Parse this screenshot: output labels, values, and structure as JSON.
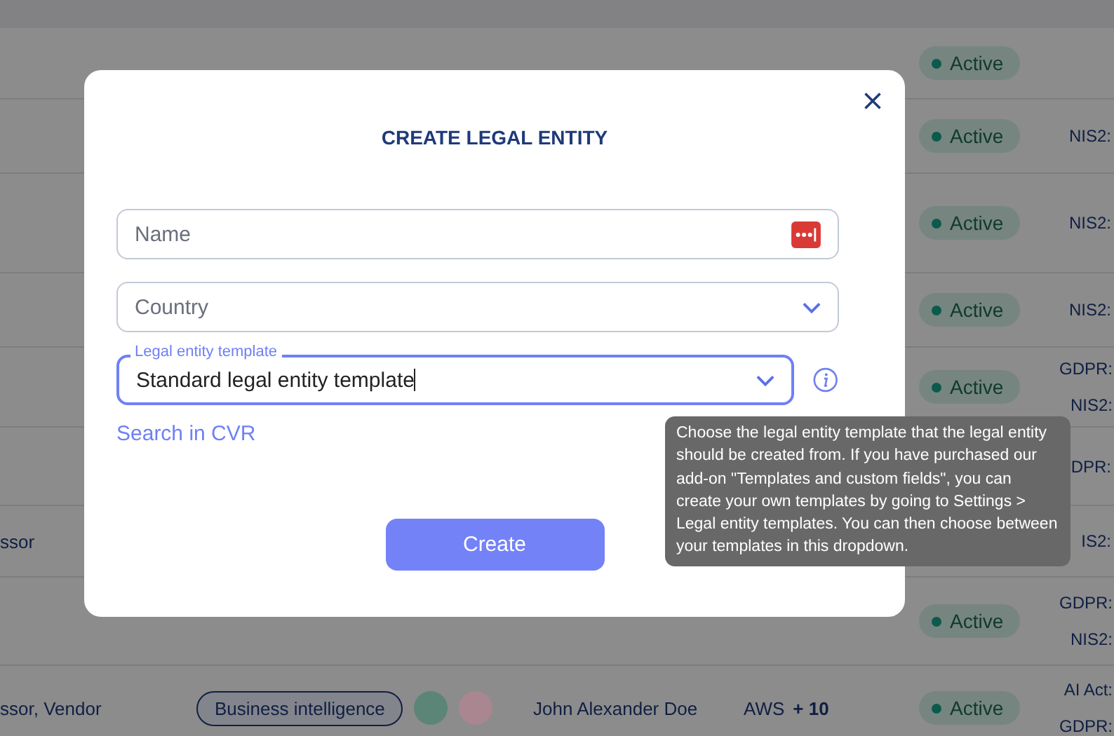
{
  "table": {
    "rows": [
      {
        "status": "Active",
        "regulations": []
      },
      {
        "status": "Active",
        "regulations": [
          "NIS2:"
        ]
      },
      {
        "status": "Active",
        "regulations": [
          "NIS2:"
        ]
      },
      {
        "status": "Active",
        "regulations": [
          "NIS2:"
        ]
      },
      {
        "status": "Active",
        "regulations": [
          "GDPR:",
          "NIS2:"
        ]
      },
      {
        "regulations": [
          "DPR:"
        ]
      },
      {
        "role": "ssor",
        "regulations": [
          "IS2:"
        ]
      },
      {
        "status": "Active",
        "regulations": [
          "GDPR:",
          "NIS2:"
        ]
      },
      {
        "role": "ssor, Vendor",
        "tags": [
          "Business intelligence"
        ],
        "circles": [
          {
            "color": "#5b8577"
          },
          {
            "color": "#a98690"
          }
        ],
        "owner": "John Alexander Doe",
        "vendor": "AWS",
        "vendor_more": "+ 10",
        "status": "Active",
        "regulations": [
          "AI Act:",
          "GDPR:"
        ]
      }
    ]
  },
  "dialog": {
    "title": "CREATE LEGAL ENTITY",
    "fields": [
      {
        "kind": "text",
        "placeholder": "Name",
        "focused": false
      },
      {
        "kind": "select",
        "placeholder": "Country",
        "focused": false
      },
      {
        "kind": "select",
        "label": "Legal entity template",
        "value": "Standard legal entity template",
        "focused": true
      }
    ],
    "link": "Search in CVR",
    "button": "Create",
    "tooltip": "Choose the legal entity template that the legal entity should be created from. If you have purchased our add-on \"Templates and custom fields\", you can create your own templates by going to Settings > Legal entity templates. You can then choose between your templates in this dropdown."
  }
}
